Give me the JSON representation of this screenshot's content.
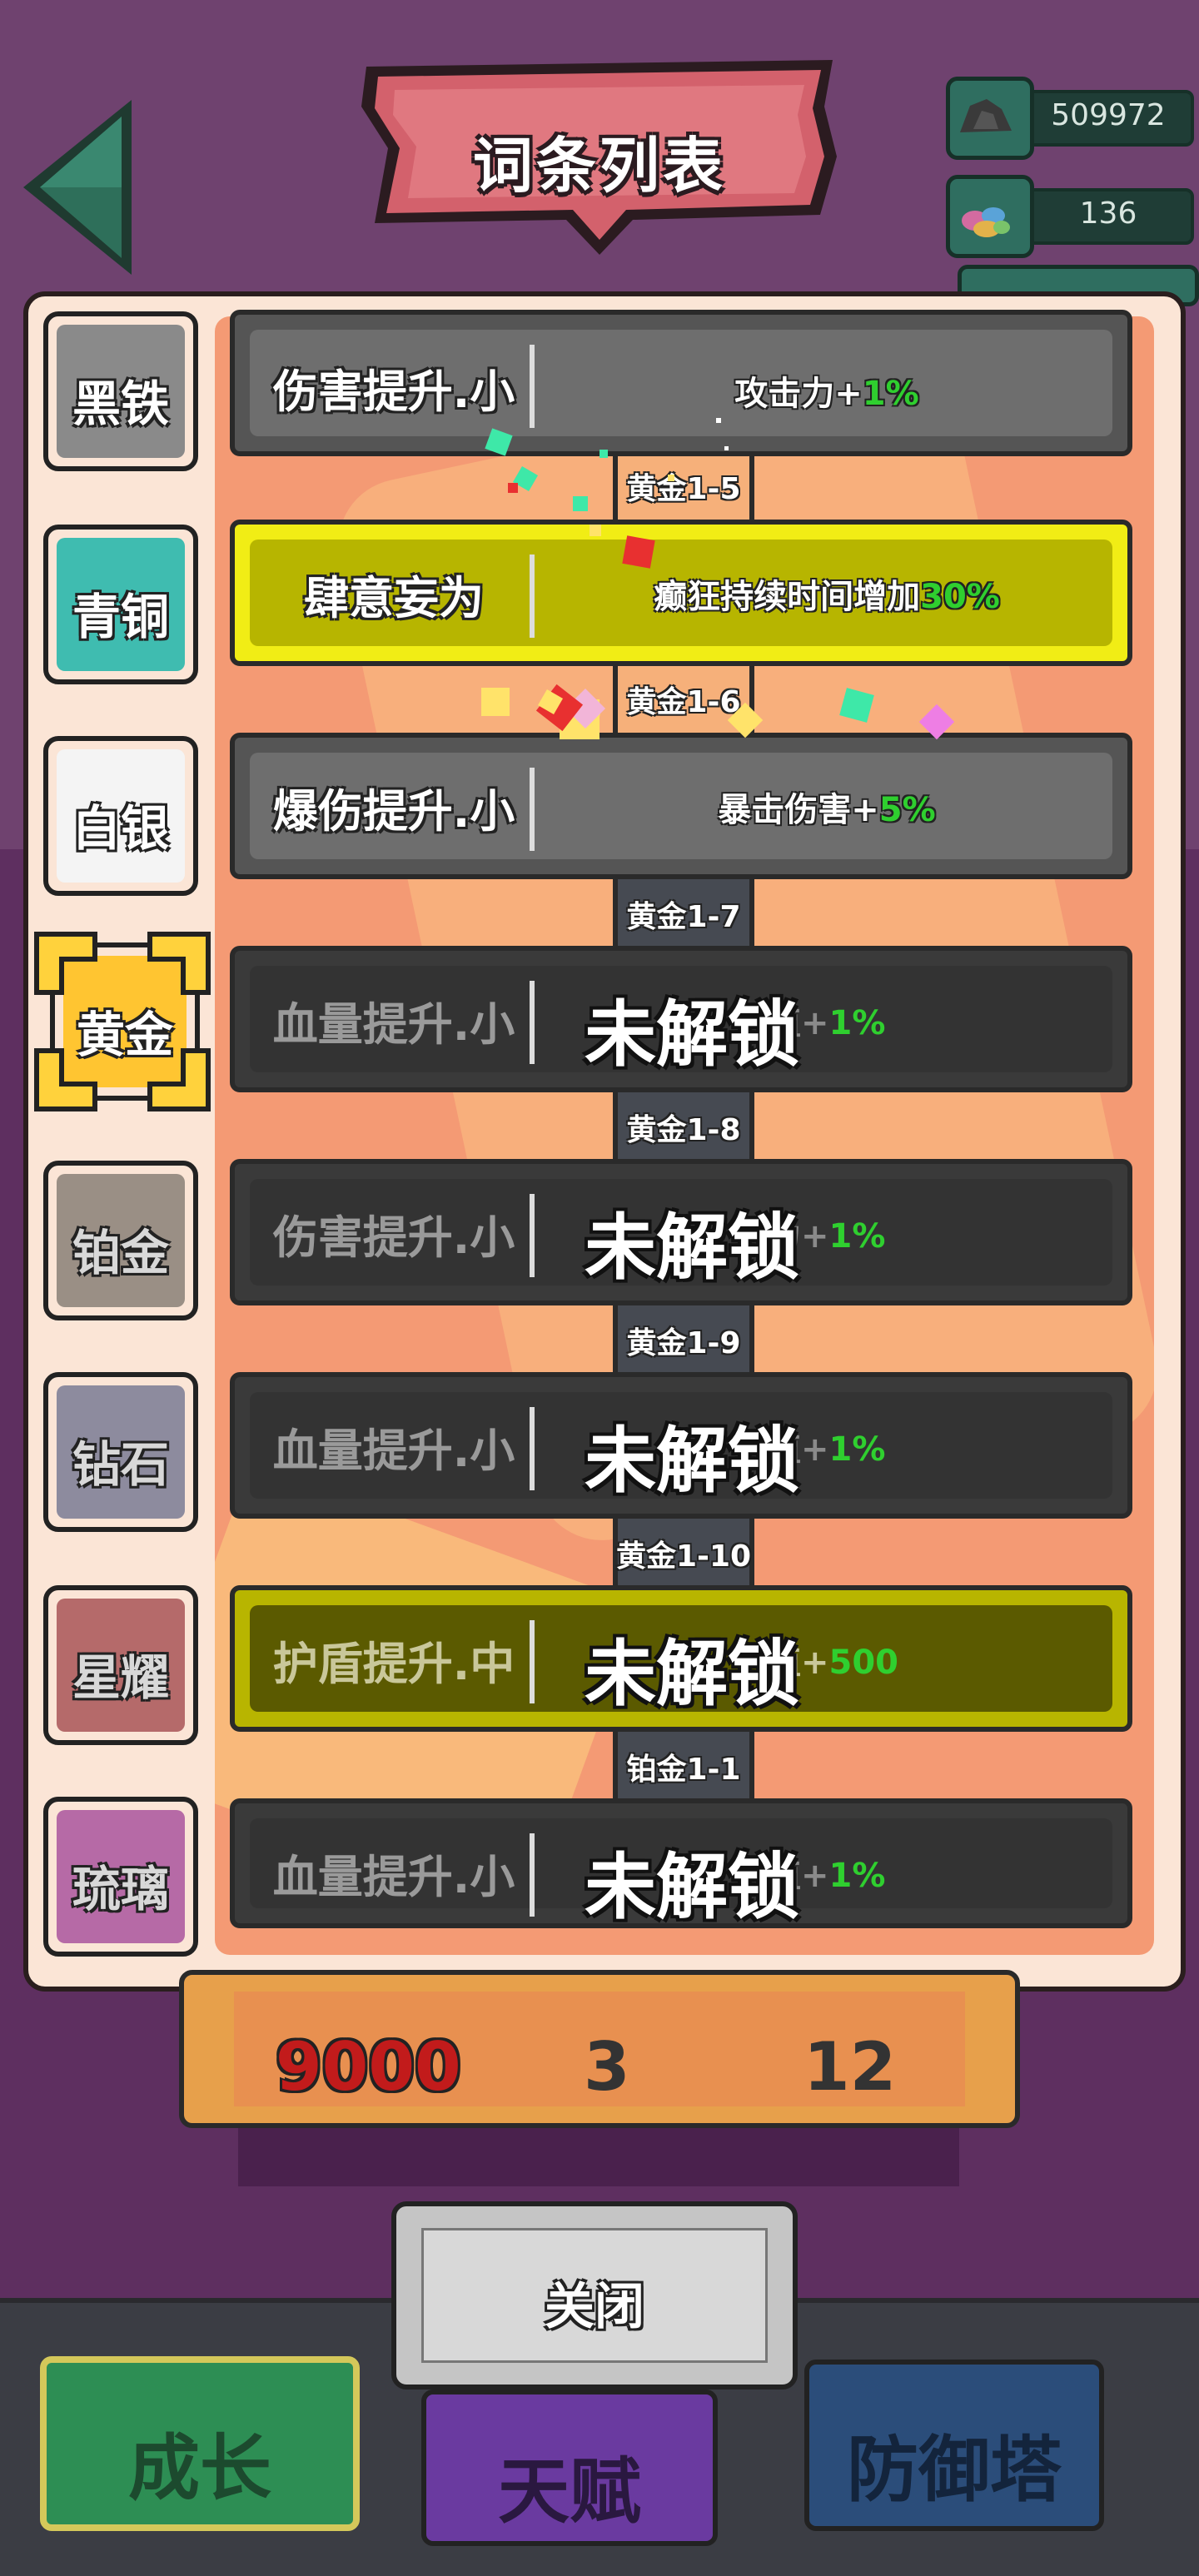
{
  "header": {
    "title": "词条列表"
  },
  "resources": [
    {
      "icon": "ore-icon",
      "value": "509972"
    },
    {
      "icon": "gems-icon",
      "value": "136"
    }
  ],
  "tabs": [
    {
      "label": "黑铁",
      "color": "#8a8a8a",
      "locked": false
    },
    {
      "label": "青铜",
      "color": "#3fbcb0",
      "locked": false
    },
    {
      "label": "白银",
      "color": "#f4f4f4",
      "locked": false
    },
    {
      "label": "黄金",
      "color": "#ffd23c",
      "locked": false,
      "selected": true
    },
    {
      "label": "铂金",
      "color": "#9a8f85",
      "locked": true
    },
    {
      "label": "钻石",
      "color": "#8d8b9e",
      "locked": true
    },
    {
      "label": "星耀",
      "color": "#b56a6a",
      "locked": true
    },
    {
      "label": "琉璃",
      "color": "#b66aa6",
      "locked": true
    }
  ],
  "entries": [
    {
      "name": "伤害提升.小",
      "effect_text": "攻击力+",
      "effect_value": "1%",
      "state": "unlocked"
    },
    {
      "name": "肆意妄为",
      "effect_text": "癫狂持续时间增加",
      "effect_value": "30%",
      "state": "gold"
    },
    {
      "name": "爆伤提升.小",
      "effect_text": "暴击伤害+",
      "effect_value": "5%",
      "state": "unlocked"
    },
    {
      "name": "血量提升.小",
      "effect_text": "值+",
      "effect_value": "1%",
      "state": "locked"
    },
    {
      "name": "伤害提升.小",
      "effect_text": "力+",
      "effect_value": "1%",
      "state": "locked"
    },
    {
      "name": "血量提升.小",
      "effect_text": "值+",
      "effect_value": "1%",
      "state": "locked"
    },
    {
      "name": "护盾提升.中",
      "effect_text": "值+",
      "effect_value": "500",
      "state": "lockedgold"
    },
    {
      "name": "血量提升.小",
      "effect_text": "值+",
      "effect_value": "1%",
      "state": "locked"
    }
  ],
  "lock_label": "未解锁",
  "connectors": [
    "黄金1-5",
    "黄金1-6",
    "黄金1-7",
    "黄金1-8",
    "黄金1-9",
    "黄金1-10",
    "铂金1-1"
  ],
  "behind_panel": {
    "values": [
      "9000",
      "3",
      "12"
    ]
  },
  "close_button": "关闭",
  "bottom_nav": [
    {
      "label": "成长",
      "active": true
    },
    {
      "label": "天赋",
      "active": false
    },
    {
      "label": "防御塔",
      "active": false
    }
  ]
}
